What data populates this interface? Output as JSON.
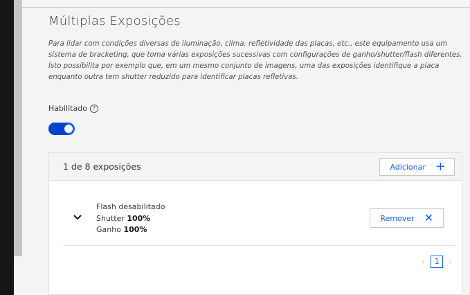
{
  "section": {
    "title": "Múltiplas Exposições",
    "description": "Para lidar com condições diversas de iluminação, clima, refletividade das placas, etc., este equipamento usa um sistema de bracketing, que toma várias exposições sucessivas com configurações de ganho/shutter/flash diferentes. Isto possibilita por exemplo que, em um mesmo conjunto de imagens, uma das exposições identifique a placa enquanto outra tem shutter reduzido para identificar placas refletivas.",
    "enabled_label": "Habilitado",
    "help_icon_glyph": "?",
    "enabled": true
  },
  "exposures": {
    "count_text": "1 de 8 exposições",
    "add_label": "Adicionar",
    "items": [
      {
        "flash": "Flash desabilitado",
        "shutter_label": "Shutter",
        "shutter_value": "100%",
        "gain_label": "Ganho",
        "gain_value": "100%",
        "remove_label": "Remover"
      }
    ]
  },
  "pagination": {
    "prev": "‹",
    "current": "1",
    "next": "›"
  },
  "colors": {
    "accent": "#0f62fe",
    "toggle_on": "#0f62fe",
    "sidebar": "#161616"
  }
}
